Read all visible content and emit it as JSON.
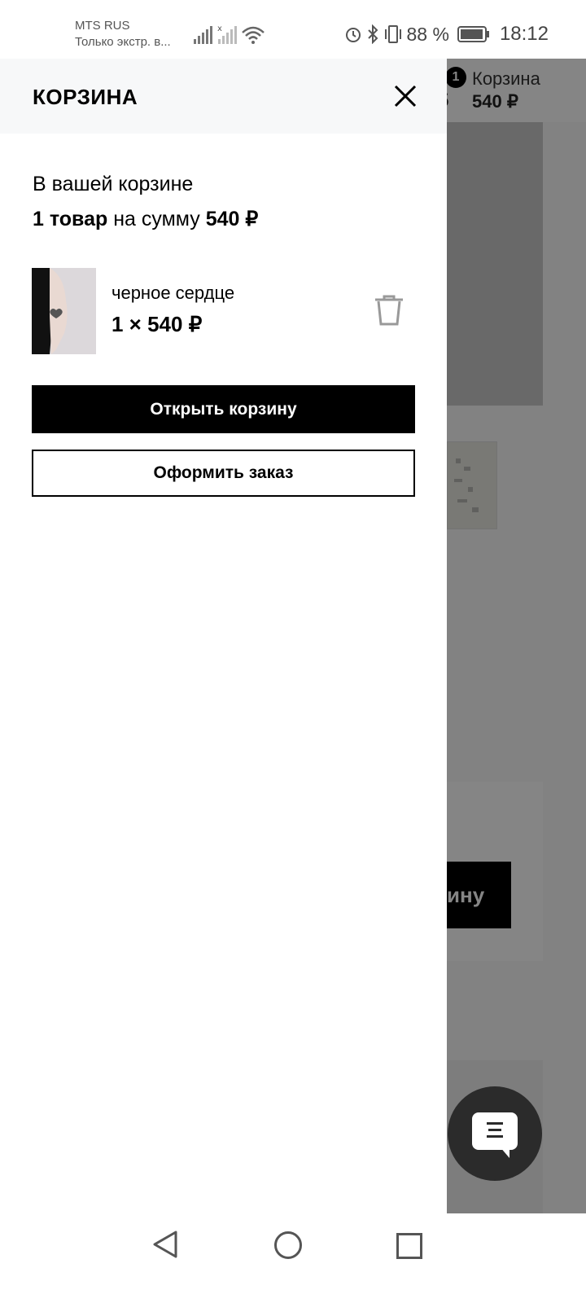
{
  "status_bar": {
    "carrier": "MTS RUS",
    "carrier_sub": "Только экстр. в...",
    "battery_percent": "88 %",
    "time": "18:12"
  },
  "background": {
    "cart_badge": "1",
    "cart_label": "Корзина",
    "cart_sum": "540 ₽",
    "partial_digit": "5",
    "card_button_partial": "ину"
  },
  "drawer": {
    "title": "КОРЗИНА",
    "summary_line1": "В вашей корзине",
    "summary_count": "1 товар",
    "summary_middle": " на сумму ",
    "summary_total": "540 ₽",
    "item": {
      "name": "черное сердце",
      "qty_price": "1 × 540 ₽"
    },
    "open_cart_label": "Открыть корзину",
    "checkout_label": "Оформить заказ"
  },
  "icons": {
    "close": "close-icon",
    "trash": "trash-icon",
    "chat": "chat-icon"
  }
}
